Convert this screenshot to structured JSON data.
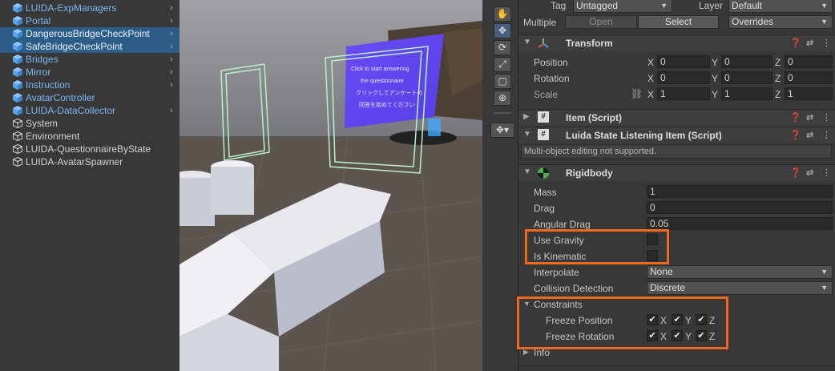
{
  "hierarchy": {
    "items": [
      {
        "label": "LUIDA-ExpManagers",
        "type": "prefab",
        "has_arrow": true,
        "selected": false
      },
      {
        "label": "Portal",
        "type": "prefab",
        "has_arrow": true,
        "selected": false
      },
      {
        "label": "DangerousBridgeCheckPoint",
        "type": "prefab",
        "has_arrow": true,
        "selected": true
      },
      {
        "label": "SafeBridgeCheckPoint",
        "type": "prefab",
        "has_arrow": true,
        "selected": true
      },
      {
        "label": "Bridges",
        "type": "prefab",
        "has_arrow": true,
        "selected": false
      },
      {
        "label": "Mirror",
        "type": "prefab",
        "has_arrow": true,
        "selected": false
      },
      {
        "label": "Instruction",
        "type": "prefab",
        "has_arrow": true,
        "selected": false
      },
      {
        "label": "AvatarController",
        "type": "prefab",
        "has_arrow": false,
        "selected": false
      },
      {
        "label": "LUIDA-DataCollector",
        "type": "prefab",
        "has_arrow": true,
        "selected": false
      },
      {
        "label": "System",
        "type": "object",
        "has_arrow": false,
        "selected": false
      },
      {
        "label": "Environment",
        "type": "object",
        "has_arrow": false,
        "selected": false
      },
      {
        "label": "LUIDA-QuestionnaireByState",
        "type": "object",
        "has_arrow": false,
        "selected": false
      },
      {
        "label": "LUIDA-AvatarSpawner",
        "type": "object",
        "has_arrow": false,
        "selected": false
      }
    ]
  },
  "scene": {
    "sign_text": [
      "Click to start answering",
      "the questionnaire",
      "クリックしてアンケートの",
      "回答を始めてください"
    ]
  },
  "inspector": {
    "tag_label": "Tag",
    "tag_value": "Untagged",
    "layer_label": "Layer",
    "layer_value": "Default",
    "multiple_label": "Multiple",
    "open_label": "Open",
    "select_label": "Select",
    "overrides_label": "Overrides",
    "transform": {
      "title": "Transform",
      "position_label": "Position",
      "rotation_label": "Rotation",
      "scale_label": "Scale",
      "x": "X",
      "y": "Y",
      "z": "Z",
      "position": [
        "0",
        "0",
        "0"
      ],
      "rotation": [
        "0",
        "0",
        "0"
      ],
      "scale": [
        "1",
        "1",
        "1"
      ]
    },
    "item_script_title": "Item (Script)",
    "state_item_title": "Luida State Listening Item (Script)",
    "multi_object_note": "Multi-object editing not supported.",
    "rigidbody": {
      "title": "Rigidbody",
      "mass_label": "Mass",
      "mass": "1",
      "drag_label": "Drag",
      "drag": "0",
      "angular_drag_label": "Angular Drag",
      "angular_drag": "0.05",
      "use_gravity_label": "Use Gravity",
      "use_gravity": false,
      "is_kinematic_label": "Is Kinematic",
      "is_kinematic": false,
      "interpolate_label": "Interpolate",
      "interpolate": "None",
      "collision_label": "Collision Detection",
      "collision": "Discrete",
      "constraints_label": "Constraints",
      "freeze_position_label": "Freeze Position",
      "freeze_rotation_label": "Freeze Rotation",
      "x": "X",
      "y": "Y",
      "z": "Z",
      "freeze_position": [
        true,
        true,
        true
      ],
      "freeze_rotation": [
        true,
        true,
        true
      ],
      "info_label": "Info"
    },
    "highlight_color": "#ee6a1f"
  }
}
